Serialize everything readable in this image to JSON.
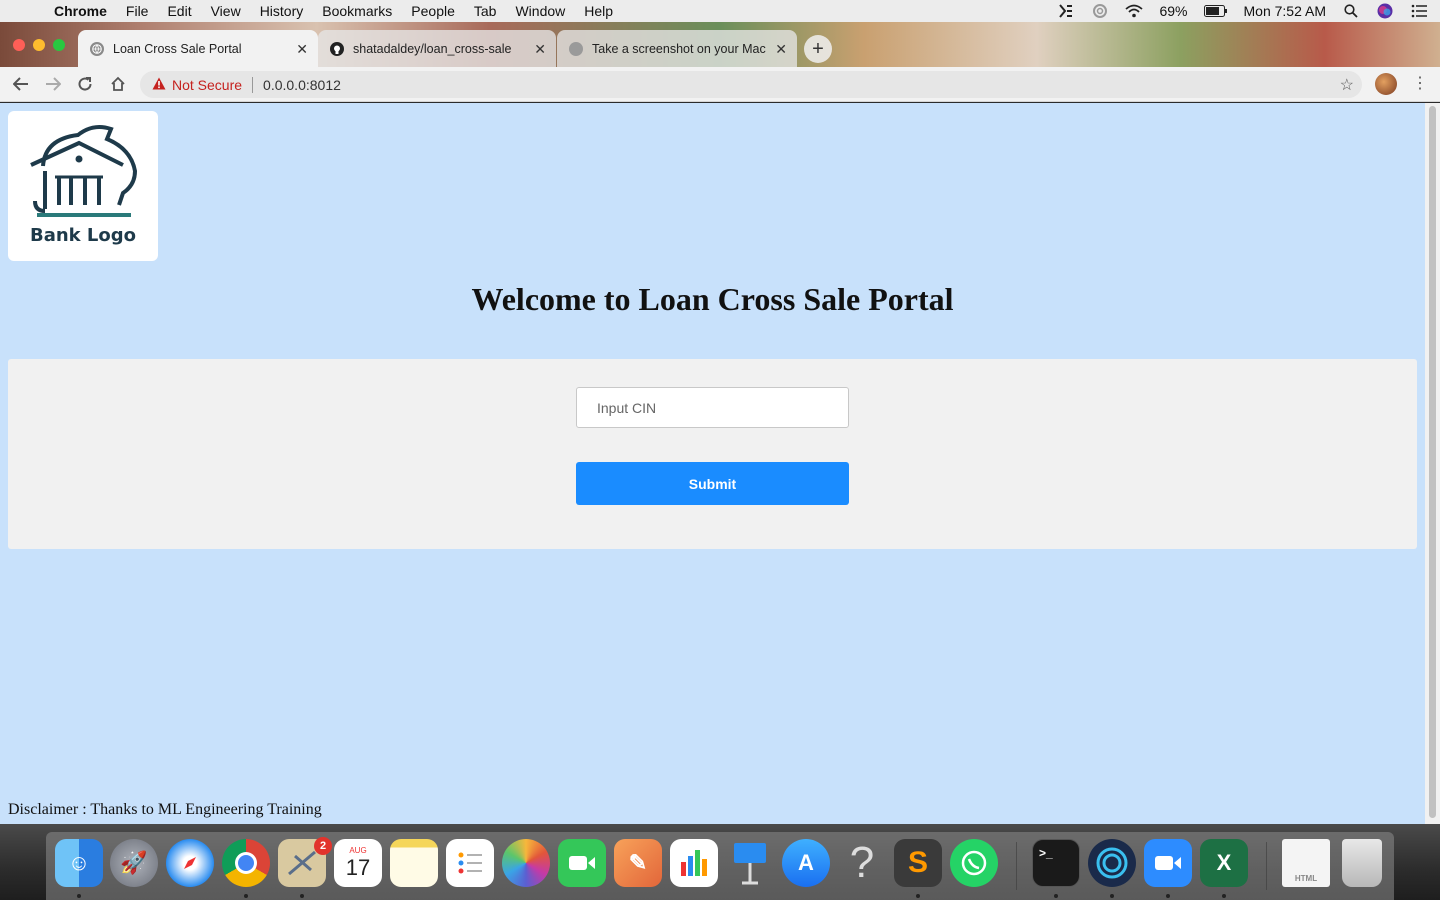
{
  "menubar": {
    "app_name": "Chrome",
    "items": [
      "File",
      "Edit",
      "View",
      "History",
      "Bookmarks",
      "People",
      "Tab",
      "Window",
      "Help"
    ],
    "battery": "69%",
    "clock": "Mon 7:52 AM"
  },
  "tabs": [
    {
      "title": "Loan Cross Sale Portal",
      "active": true
    },
    {
      "title": "shatadaldey/loan_cross-sale",
      "active": false
    },
    {
      "title": "Take a screenshot on your Mac",
      "active": false
    }
  ],
  "omnibox": {
    "security_label": "Not Secure",
    "url": "0.0.0.0:8012"
  },
  "page": {
    "logo_text": "Bank Logo",
    "heading": "Welcome to Loan Cross Sale Portal",
    "cin_placeholder": "Input CIN",
    "cin_value": "",
    "submit_label": "Submit",
    "disclaimer": "Disclaimer : Thanks to ML Engineering Training"
  },
  "dock": {
    "apps": [
      "Finder",
      "Launchpad",
      "Safari",
      "Chrome",
      "Mail",
      "Calendar",
      "Notes",
      "Reminders",
      "Photos",
      "FaceTime",
      "Pages",
      "Numbers",
      "Keynote",
      "App Store",
      "Help",
      "Sublime Text",
      "WhatsApp",
      "Terminal",
      "Webex",
      "Zoom",
      "Excel",
      "HTML Document",
      "Trash"
    ],
    "calendar_month": "AUG",
    "calendar_day": "17",
    "mail_badge": "2"
  },
  "colors": {
    "page_background": "#c8e1fb",
    "submit_button": "#1a8cff",
    "form_panel": "#f1f1f1",
    "warning_red": "#c5221f"
  }
}
